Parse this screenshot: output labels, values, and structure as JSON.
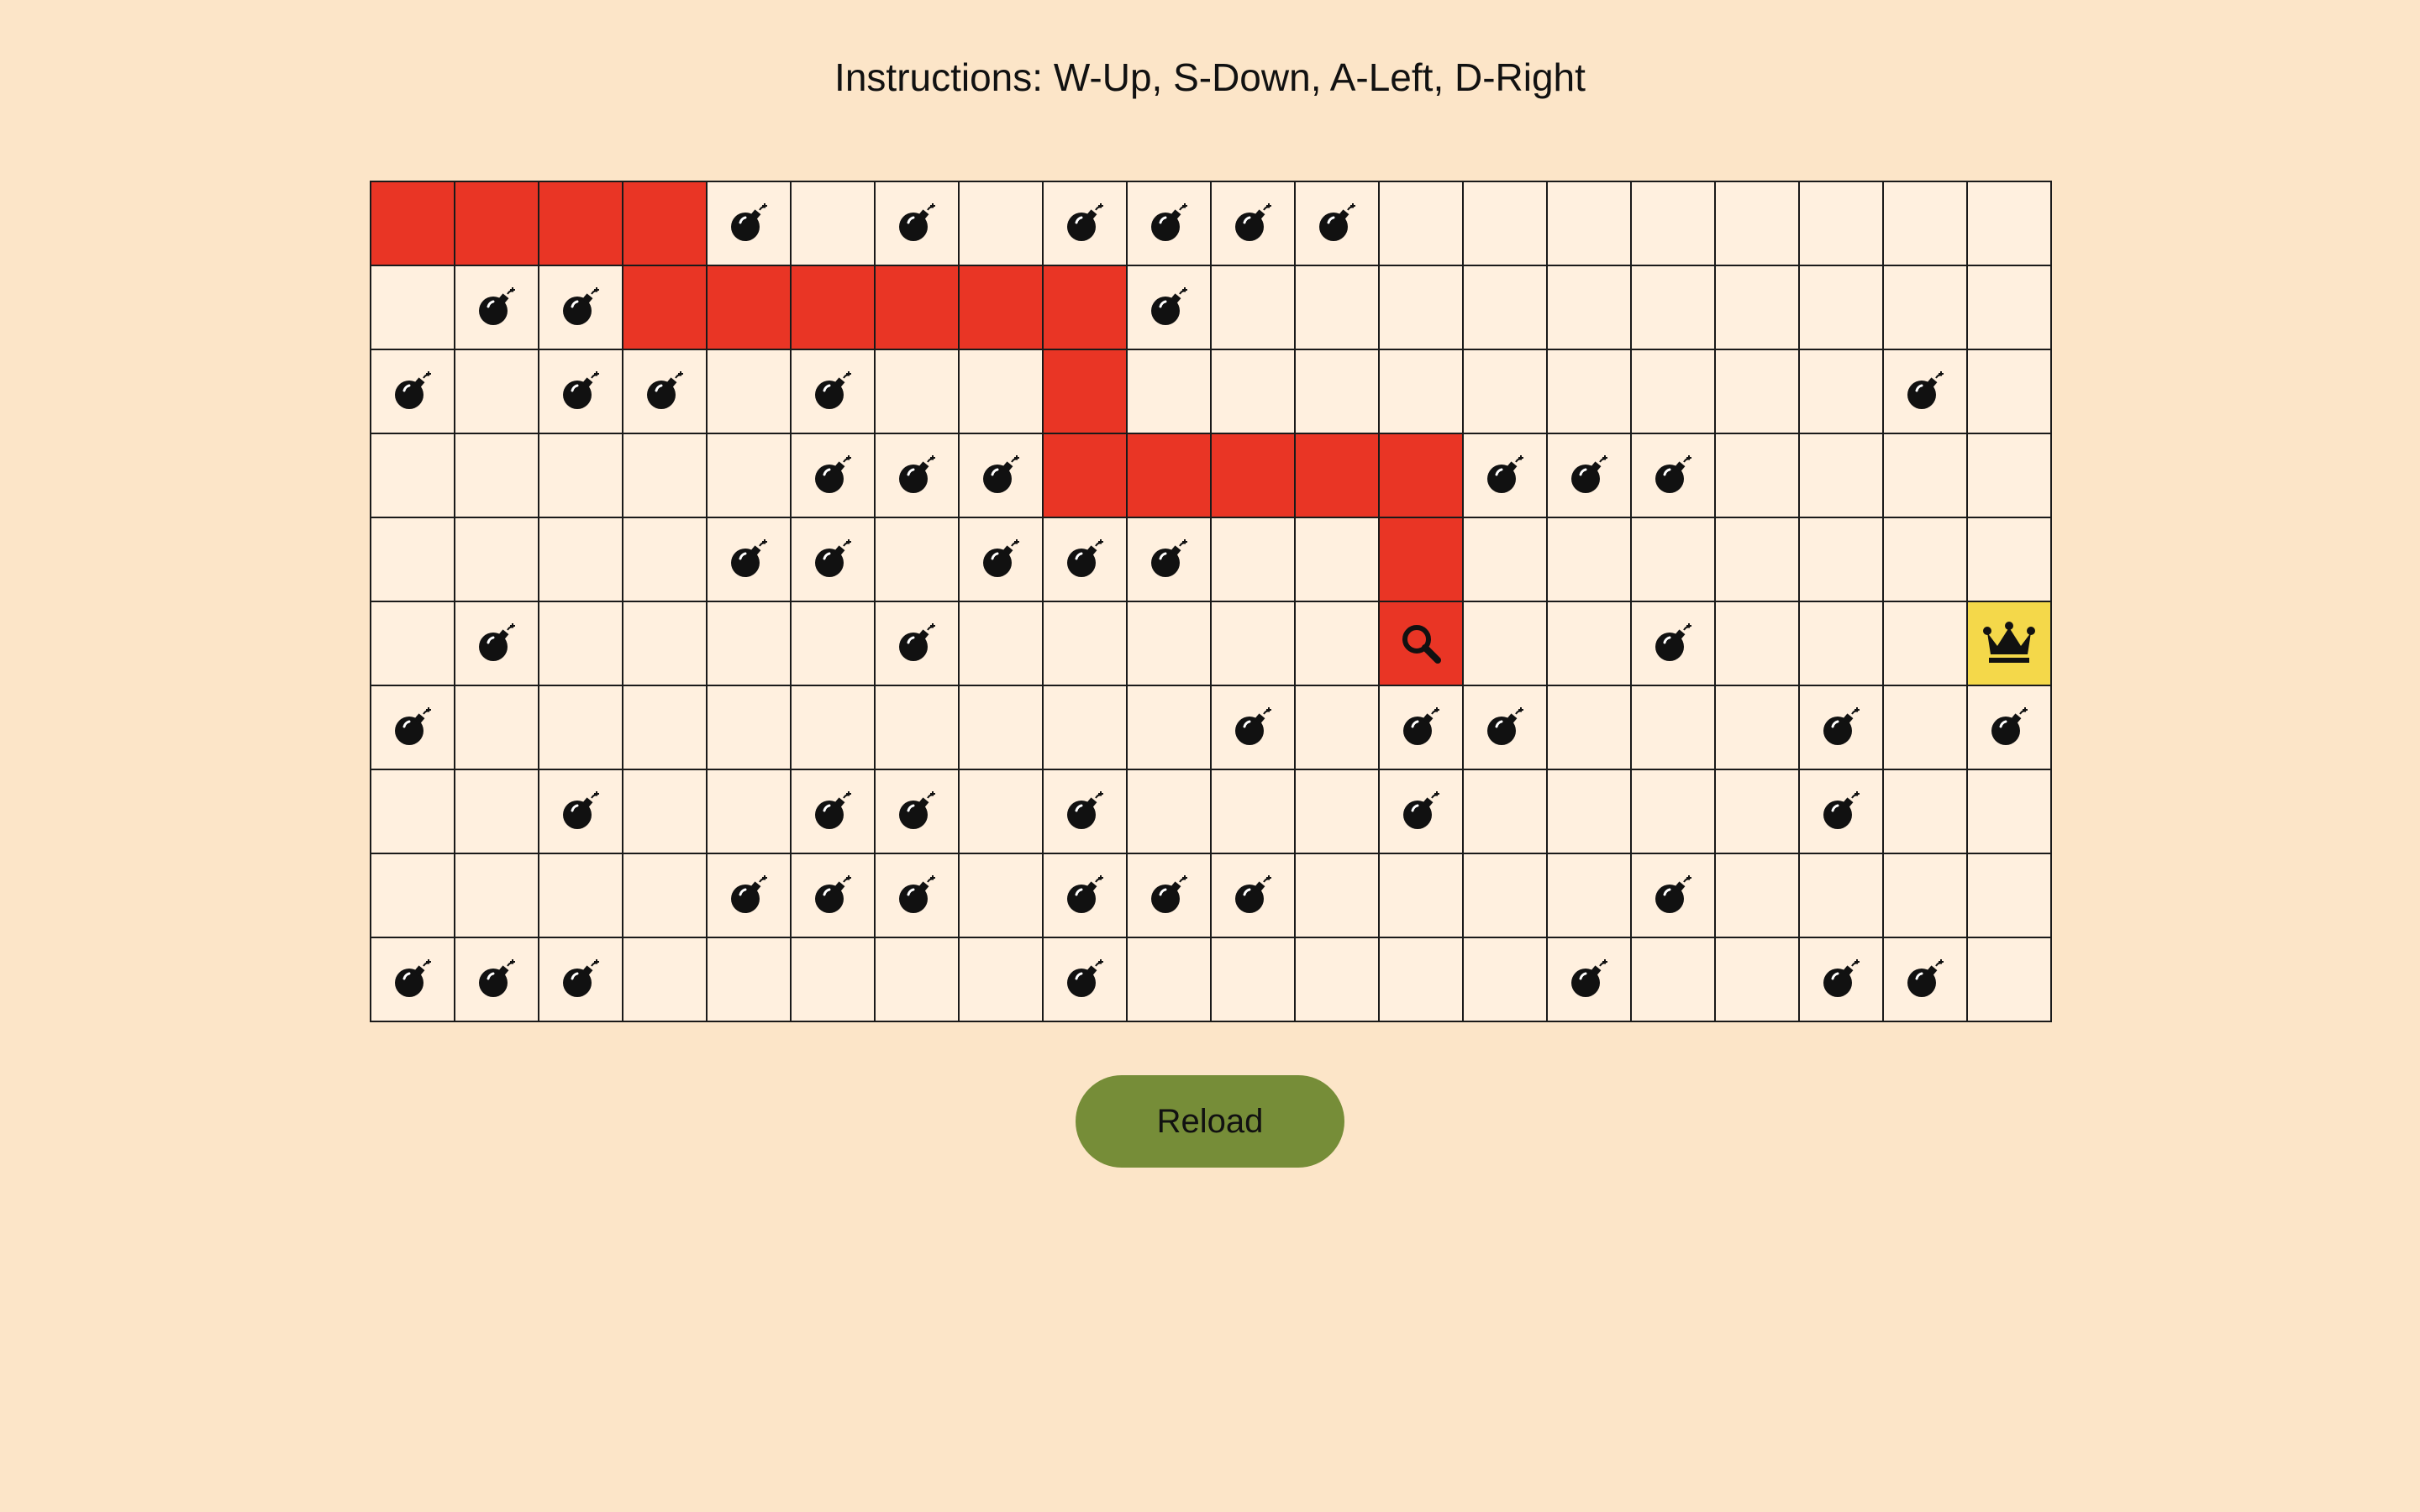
{
  "instructions": "Instructions: W-Up, S-Down, A-Left, D-Right",
  "reload_label": "Reload",
  "colors": {
    "background": "#fce5c8",
    "cell": "#fff0df",
    "path": "#e93525",
    "goal": "#f4d84a",
    "button": "#768d38"
  },
  "legend": {
    ".": "empty",
    "B": "bomb-icon",
    "R": "visited-path",
    "P": "player-magnifier-icon",
    "G": "goal-crown-icon"
  },
  "board": {
    "rows": 10,
    "cols": 20,
    "cells": [
      "RRRRB.B.BBBB........",
      ".BBRRRRRRB..........",
      "B.BB.B..R.........B.",
      ".....BBBRRRRRBBB....",
      "....BB.BBB..R.......",
      ".B....B.....P..B...G",
      "B.........B.BB...B.B.",
      "..B..BB.B...B....B..",
      "....BBB.BBB....B....",
      "BBB.....B.....B..BB."
    ]
  }
}
